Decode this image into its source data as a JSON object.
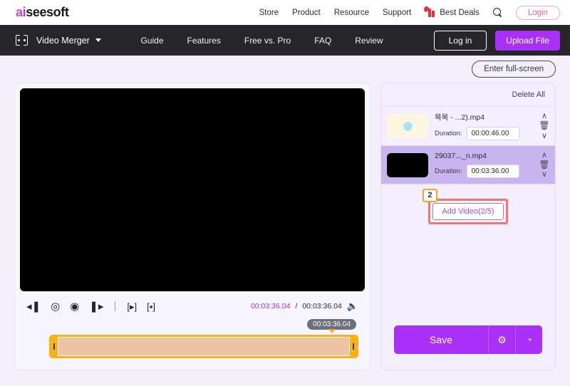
{
  "brand": {
    "logo_ai": "ai",
    "logo_rest": "seesoft"
  },
  "topnav": {
    "links": [
      "Store",
      "Product",
      "Resource",
      "Support"
    ],
    "best_deals": "Best Deals",
    "search_icon": "search-icon",
    "login_label": "Login"
  },
  "darknav": {
    "tool_icon": "video-merger-icon",
    "tool_name": "Video Merger",
    "links": [
      "Guide",
      "Features",
      "Free vs. Pro",
      "FAQ",
      "Review"
    ],
    "login_label": "Log in",
    "upload_label": "Upload File"
  },
  "toolbar": {
    "fullscreen_label": "Enter full-screen"
  },
  "player": {
    "controls": {
      "rewind": "⏪",
      "play": "▶",
      "stop": "■",
      "forward": "⏩",
      "trim_play": "▶",
      "trim_stop": "■"
    },
    "current_time": "00:03:36.04",
    "separator": "/",
    "total_time": "00:03:36.04",
    "volume_icon": "volume-icon",
    "timeline_tooltip": "00:03:36.04"
  },
  "sidebar": {
    "delete_all": "Delete All",
    "videos": [
      {
        "name": "목목 - ...2).mp4",
        "duration_label": "Duration:",
        "duration": "00:00:46.00",
        "thumb": "cream",
        "selected": false
      },
      {
        "name": "29037..._n.mp4",
        "duration_label": "Duration:",
        "duration": "00:03:36.00",
        "thumb": "black",
        "selected": true
      }
    ],
    "add_video": {
      "label": "Add Video(2/5)",
      "step_badge": "2"
    },
    "footer": {
      "save_label": "Save",
      "settings_icon": "⚙",
      "history_icon": "◔"
    }
  },
  "colors": {
    "accent_purple": "#a930f7",
    "highlight_red": "#f2776a",
    "badge_orange": "#f4a62a",
    "timeline_orange": "#fbb017"
  }
}
